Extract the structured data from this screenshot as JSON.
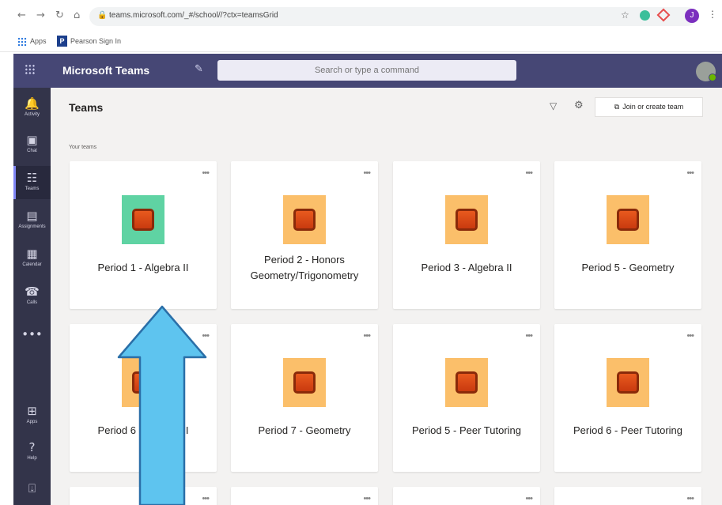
{
  "browser": {
    "url": "teams.microsoft.com/_#/school//?ctx=teamsGrid",
    "avatar_initial": "J",
    "bookmarks": [
      "Apps",
      "Pearson Sign In"
    ]
  },
  "header": {
    "app_title": "Microsoft Teams",
    "search_placeholder": "Search or type a command"
  },
  "rail": [
    {
      "glyph": "🔔",
      "label": "Activity"
    },
    {
      "glyph": "▣",
      "label": "Chat"
    },
    {
      "glyph": "☷",
      "label": "Teams"
    },
    {
      "glyph": "▤",
      "label": "Assignments"
    },
    {
      "glyph": "▦",
      "label": "Calendar"
    },
    {
      "glyph": "☎",
      "label": "Calls"
    },
    {
      "glyph": "⊞",
      "label": "Apps"
    },
    {
      "glyph": "?",
      "label": "Help"
    }
  ],
  "page": {
    "title": "Teams",
    "join_label": "Join or create team",
    "section_label": "Your teams"
  },
  "teams": [
    {
      "name": "Period 1 - Algebra II",
      "tile_color": "#5fd3a3"
    },
    {
      "name": "Period 2 - Honors Geometry/Trigonometry",
      "tile_color": "#fbbf6a"
    },
    {
      "name": "Period 3 - Algebra II",
      "tile_color": "#fbbf6a"
    },
    {
      "name": "Period 5 - Geometry",
      "tile_color": "#fbbf6a"
    },
    {
      "name": "Period 6 - Algebra II",
      "tile_color": "#fbbf6a"
    },
    {
      "name": "Period 7 - Geometry",
      "tile_color": "#fbbf6a"
    },
    {
      "name": "Period 5 - Peer Tutoring",
      "tile_color": "#fbbf6a"
    },
    {
      "name": "Period 6 - Peer Tutoring",
      "tile_color": "#fbbf6a"
    }
  ],
  "more_label": "•••",
  "colors": {
    "header": "#464775",
    "rail": "#33344a",
    "arrow_fill": "#5ec4ef",
    "arrow_stroke": "#2a6fa8"
  }
}
